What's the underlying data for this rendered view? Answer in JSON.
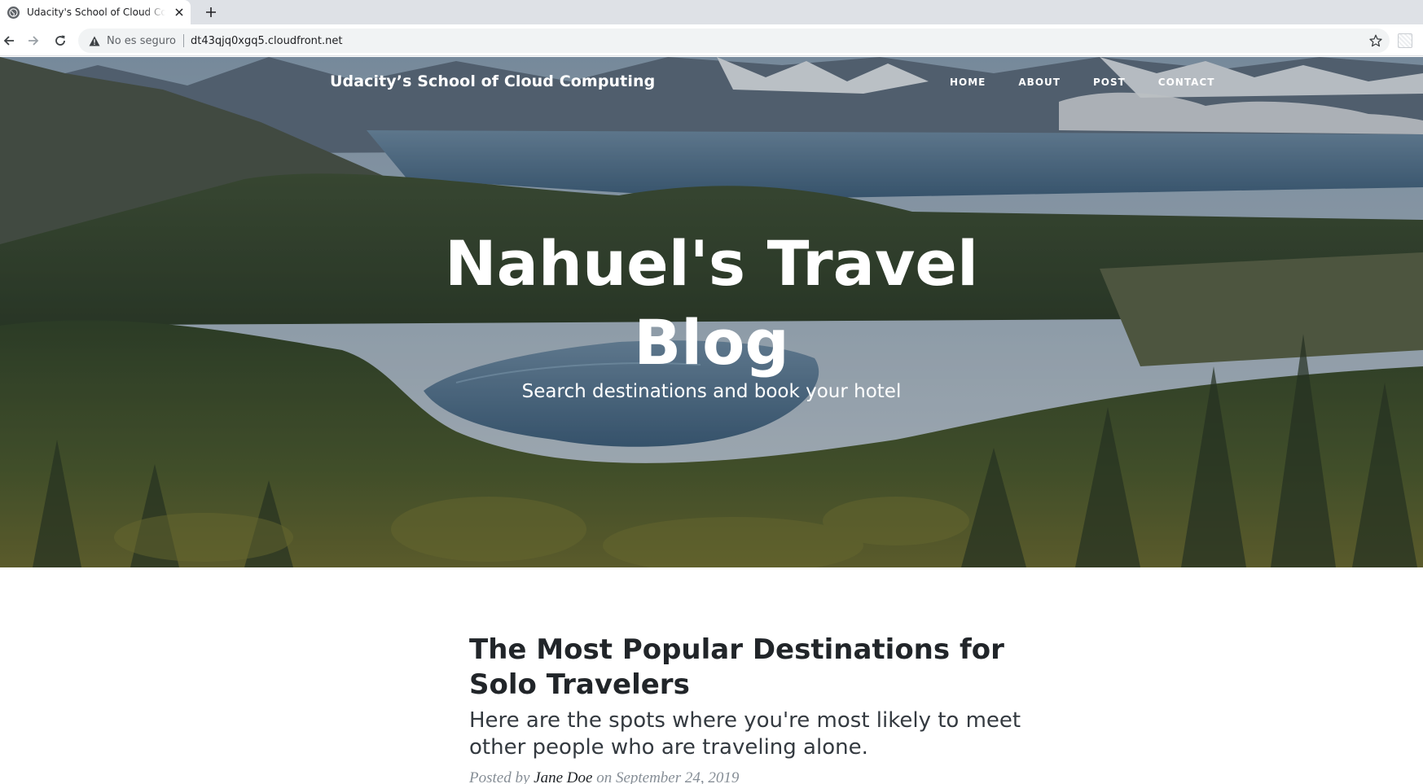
{
  "browser": {
    "tab": {
      "title": "Udacity's School of Cloud Computing",
      "favicon": "globe-icon",
      "close_icon": "close-icon"
    },
    "new_tab_icon": "plus-icon",
    "toolbar": {
      "back_icon": "arrow-left-icon",
      "forward_icon": "arrow-right-icon",
      "reload_icon": "reload-icon",
      "security_icon": "warning-icon",
      "security_label": "No es seguro",
      "url": "dt43qjq0xgq5.cloudfront.net",
      "bookmark_icon": "star-icon",
      "extension_icon": "extension-icon"
    }
  },
  "site": {
    "brand": "Udacity’s School of Cloud Computing",
    "nav": [
      {
        "label": "HOME"
      },
      {
        "label": "ABOUT"
      },
      {
        "label": "POST"
      },
      {
        "label": "CONTACT"
      }
    ],
    "hero": {
      "title_line1": "Nahuel's Travel",
      "title_line2": "Blog",
      "subtitle": "Search destinations and book your hotel",
      "background": "mountain-lake-forest-landscape"
    },
    "post": {
      "title": "The Most Popular Destinations for Solo Travelers",
      "subtitle": "Here are the spots where you're most likely to meet other people who are traveling alone.",
      "meta_prefix": "Posted by",
      "author": "Jane Doe",
      "meta_on": "on",
      "date": "September 24, 2019"
    }
  },
  "colors": {
    "chrome_bg": "#dee1e6",
    "omnibox_bg": "#f1f3f4",
    "text_dark": "#212529",
    "meta_gray": "#868e96"
  }
}
